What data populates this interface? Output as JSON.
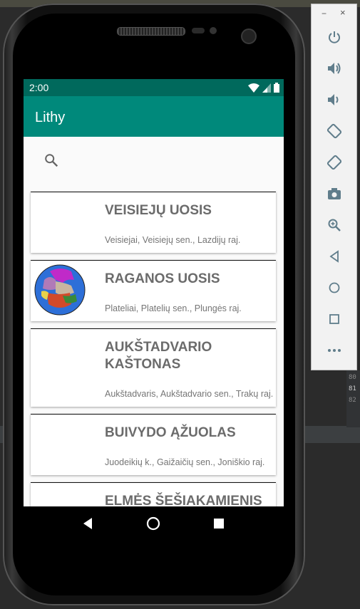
{
  "status_bar": {
    "time": "2:00"
  },
  "app": {
    "title": "Lithy"
  },
  "trees": [
    {
      "name": "VEISIEJŲ UOSIS",
      "location": "Veisiejai, Veisiejų sen., Lazdijų raj."
    },
    {
      "name": "RAGANOS UOSIS",
      "location": "Plateliai, Platelių sen., Plungės raj."
    },
    {
      "name": "AUKŠTADVARIO KAŠTONAS",
      "location": "Aukštadvaris, Aukštadvario sen., Trakų raj."
    },
    {
      "name": "BUIVYDO ĄŽUOLAS",
      "location": "Juodeikių k., Gaižaičių sen., Joniškio raj."
    },
    {
      "name": "ELMĖS ŠEŠIAKAMIENIS",
      "location": ""
    }
  ],
  "emulator": {
    "minimize": "−",
    "close": "×",
    "tools": [
      "power-icon",
      "volume-up-icon",
      "volume-down-icon",
      "rotate-left-icon",
      "rotate-right-icon",
      "camera-icon",
      "zoom-icon",
      "back-icon",
      "home-icon",
      "overview-icon",
      "more-icon"
    ]
  },
  "ide": {
    "line_numbers": [
      "80",
      "81",
      "82"
    ]
  },
  "colors": {
    "status_bar": "#00695c",
    "app_bar": "#00897b",
    "title_text": "#6b6b6b"
  }
}
